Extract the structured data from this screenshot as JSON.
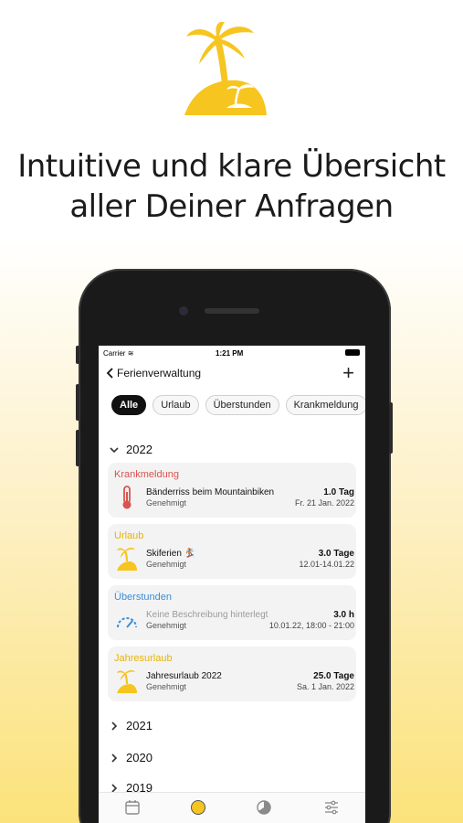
{
  "headline": {
    "line1": "Intuitive und klare Übersicht",
    "line2": "aller Deiner Anfragen"
  },
  "status_bar": {
    "carrier": "Carrier",
    "time": "1:21 PM"
  },
  "nav": {
    "back_label": "Ferienverwaltung",
    "add_icon": "plus-icon"
  },
  "filters": [
    "Alle",
    "Urlaub",
    "Überstunden",
    "Krankmeldung"
  ],
  "active_filter": "Alle",
  "years": [
    "2022",
    "2021",
    "2020",
    "2019"
  ],
  "entries": [
    {
      "category": "Krankmeldung",
      "category_color": "#d9534f",
      "icon": "thermometer-icon",
      "title": "Bänderriss beim Mountainbiken",
      "status": "Genehmigt",
      "amount": "1.0 Tag",
      "date": "Fr. 21 Jan. 2022"
    },
    {
      "category": "Urlaub",
      "category_color": "#e8b400",
      "icon": "palm-island-icon",
      "title": "Skiferien 🏂",
      "status": "Genehmigt",
      "amount": "3.0 Tage",
      "date": "12.01-14.01.22"
    },
    {
      "category": "Überstunden",
      "category_color": "#3b8fd6",
      "icon": "speedometer-icon",
      "title": "Keine Beschreibung hinterlegt",
      "status": "Genehmigt",
      "amount": "3.0 h",
      "date": "10.01.22, 18:00 - 21:00"
    },
    {
      "category": "Jahresurlaub",
      "category_color": "#e8b400",
      "icon": "palm-island-icon",
      "title": "Jahresurlaub 2022",
      "status": "Genehmigt",
      "amount": "25.0 Tage",
      "date": "Sa. 1 Jan. 2022"
    }
  ],
  "tabbar": [
    "calendar-icon",
    "palm-icon",
    "chart-icon",
    "settings-sliders-icon"
  ],
  "colors": {
    "accent": "#f5c92b",
    "background_gradient_end": "#fbe27a"
  }
}
